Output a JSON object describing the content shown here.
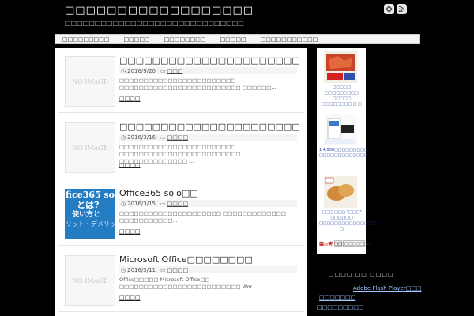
{
  "header": {
    "site_title": "□□□□□□□□□□□□□□□□□□",
    "tagline": "□□□□□□□□□□□□□□□□□□□□□□□□□□□□□□",
    "feedly_icon": "feedly-icon",
    "rss_icon": "rss-icon"
  },
  "nav": {
    "items": [
      {
        "label": "□□□□□□□□□"
      },
      {
        "label": "□□□□□"
      },
      {
        "label": "□□□□□□□□"
      },
      {
        "label": "□□□□□"
      },
      {
        "label": "□□□□□□□□□□□"
      }
    ]
  },
  "posts": [
    {
      "thumb": "NO IMAGE",
      "title": "□□□□□□□□□□□□□□□□□□□□□□",
      "date": "2016/9/20",
      "category": "□□□",
      "excerpt": "□□□□□□□□□□□□□□□□□□□□□□□□ □□□□□□□□□□□□□□□□□□□□□□□□□ □□□□□□...",
      "more": "□□□□"
    },
    {
      "thumb": "NO IMAGE",
      "title": "□□□□□□□□□□□□□□□□□□□□□□",
      "date": "2016/3/16",
      "category": "□□□□",
      "excerpt": "□□□□□□□□□□□□□□□□□□□□□□□□ □□□□□□□□□□□□□□□□□□□□□□□□□ □□□□□□□□□□□□□□ ...",
      "more": "□□□□"
    },
    {
      "thumb_lines": [
        "fice365 so",
        "とは?",
        "使い方と",
        "リット・デメリッ"
      ],
      "title": "Office365 solo□□",
      "date": "2016/3/15",
      "category": "□□□□",
      "excerpt": "□□□□□□□□□□□□□□□□□□□□□ □□□□□□□□□□□□□ □□□□□□□□□□□...",
      "more": "□□□□"
    },
    {
      "thumb": "NO IMAGE",
      "title": "Microsoft Office□□□□□□□□",
      "date": "2016/3/11",
      "category": "□□□□",
      "excerpt": "Office□□□□□ Microsoft Office□□ □□□□□□□□□□□□□□□□□□□□□□□□□ Wor...",
      "more": "□□□□"
    }
  ],
  "sidebar": {
    "ads": [
      {
        "text": "□□□□□ □□□□□□□□□ □□□□□ □□□□□□□□ □ □"
      },
      {
        "text": "1.4,000□□□□□□□□□ □□□□□□□□□□□□□"
      },
      {
        "text": "□□□ □□□ \"□□□\" □□□□□□ □□□□□□□□□□□□□□□ □"
      }
    ],
    "rakuten": "楽◎天",
    "ad_btn1": "□□",
    "ad_btn2": "□□□□□□□□□",
    "heading": "□□□□ □□ □□□□",
    "links": [
      {
        "label": "Adobe Flash Player□□□"
      },
      {
        "label": "□□□□□□□"
      },
      {
        "label": "□□□□□□□□□"
      }
    ]
  }
}
